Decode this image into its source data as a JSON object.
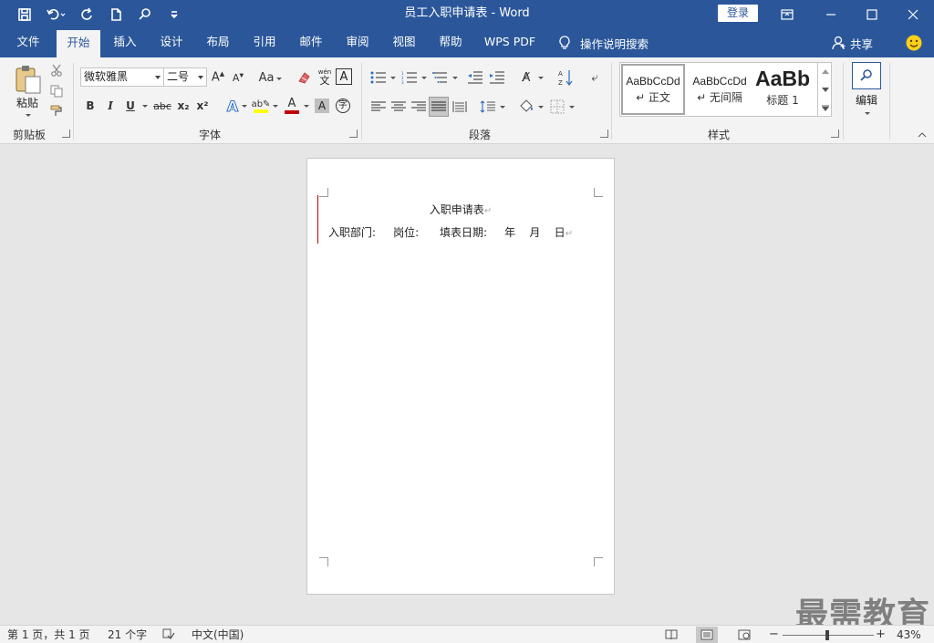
{
  "window": {
    "title": "员工入职申请表  -  Word",
    "login_label": "登录"
  },
  "tabs": [
    {
      "label": "文件"
    },
    {
      "label": "开始"
    },
    {
      "label": "插入"
    },
    {
      "label": "设计"
    },
    {
      "label": "布局"
    },
    {
      "label": "引用"
    },
    {
      "label": "邮件"
    },
    {
      "label": "审阅"
    },
    {
      "label": "视图"
    },
    {
      "label": "帮助"
    },
    {
      "label": "WPS PDF"
    }
  ],
  "active_tab": "开始",
  "tell_me": "操作说明搜索",
  "share_label": "共享",
  "ribbon": {
    "clipboard": {
      "paste_label": "粘贴",
      "group_label": "剪贴板"
    },
    "font": {
      "font_name": "微软雅黑",
      "font_size": "二号",
      "group_label": "字体",
      "case_label": "Aa",
      "phonetic_top": "wén",
      "phonetic_bottom": "文",
      "bold": "B",
      "italic": "I",
      "underline": "U",
      "strike": "abc",
      "sub": "x₂",
      "sup": "x²",
      "border_char": "A",
      "enclose_char": "字"
    },
    "paragraph": {
      "group_label": "段落"
    },
    "styles": {
      "group_label": "样式",
      "items": [
        {
          "sample": "AaBbCcDd",
          "name": "↵ 正文"
        },
        {
          "sample": "AaBbCcDd",
          "name": "↵ 无间隔"
        },
        {
          "sample": "AaBb",
          "name": "标题 1"
        }
      ]
    },
    "editing": {
      "label": "编辑"
    }
  },
  "document": {
    "title": "入职申请表",
    "line1": "入职部门:     岗位:      填表日期:     年    月    日"
  },
  "watermark": "最需教育",
  "statusbar": {
    "page": "第 1 页，共 1 页",
    "words": "21 个字",
    "language": "中文(中国)",
    "zoom": "43%"
  },
  "colors": {
    "brand": "#2b579a",
    "highlight": "#ffff00",
    "font_color": "#c00000"
  }
}
